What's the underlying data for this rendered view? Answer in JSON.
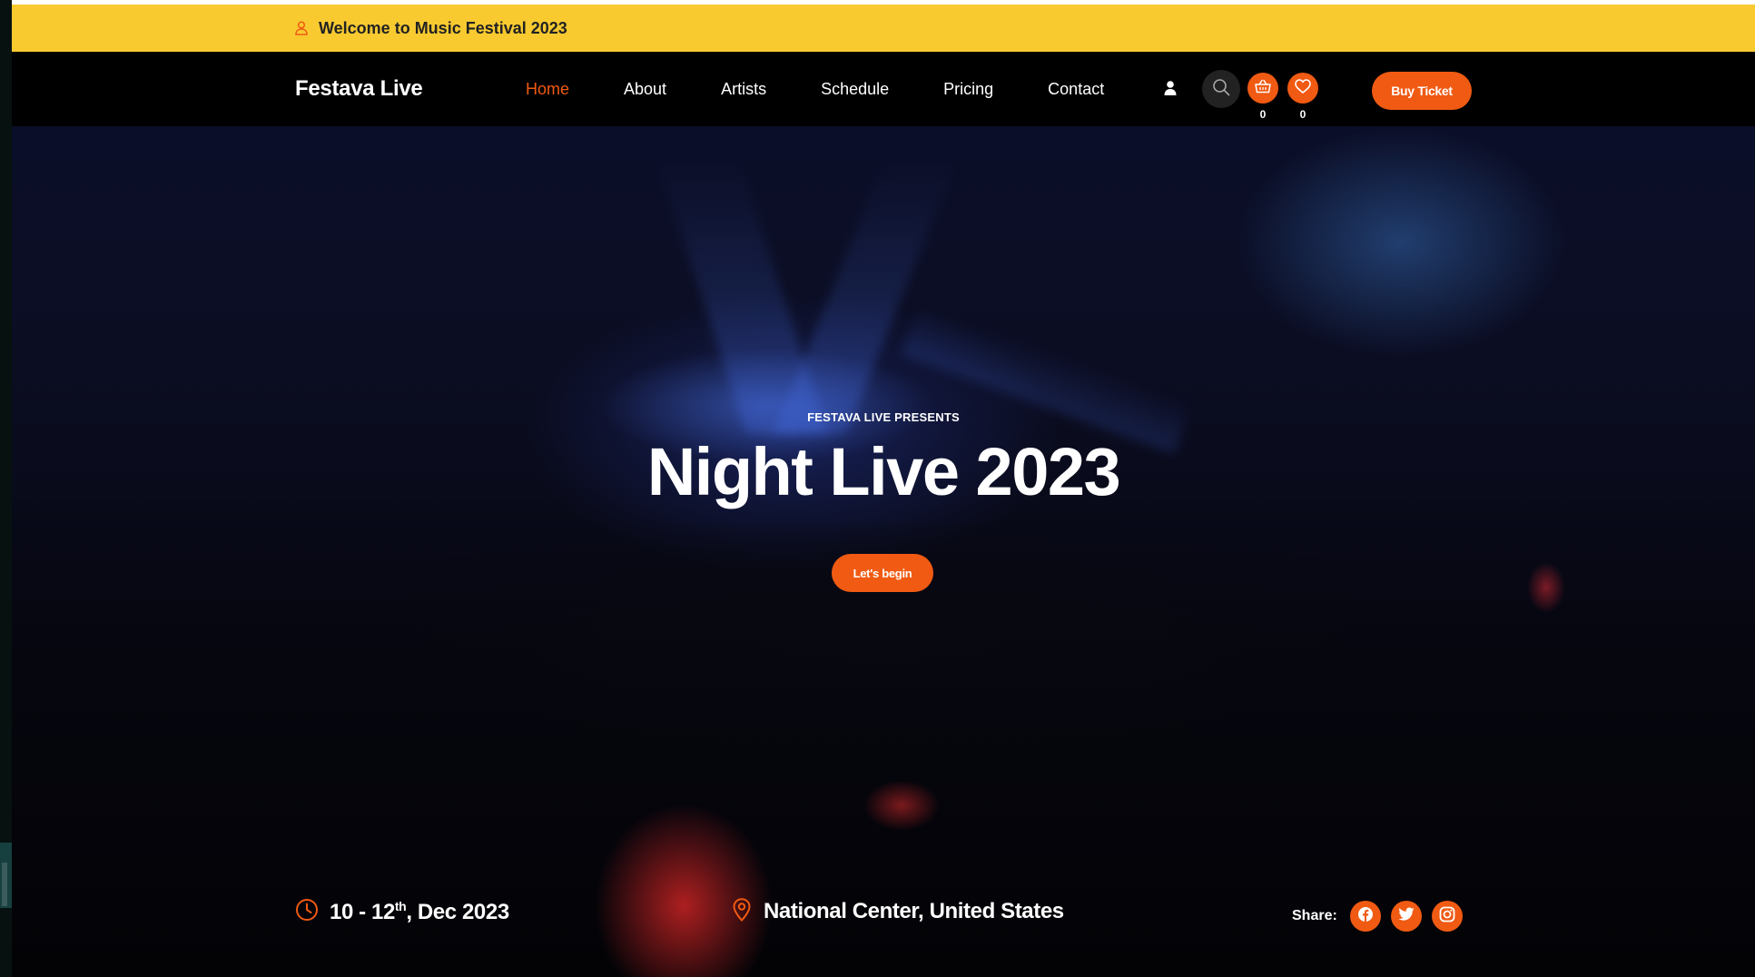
{
  "colors": {
    "accent": "#f05a12",
    "announcement_bg": "#f8ca30",
    "nav_bg": "#000000"
  },
  "announcement": {
    "icon": "user-outline-icon",
    "text": "Welcome to Music Festival 2023"
  },
  "header": {
    "logo": "Festava Live",
    "nav": [
      {
        "label": "Home",
        "active": true
      },
      {
        "label": "About",
        "active": false
      },
      {
        "label": "Artists",
        "active": false
      },
      {
        "label": "Schedule",
        "active": false
      },
      {
        "label": "Pricing",
        "active": false
      },
      {
        "label": "Contact",
        "active": false
      }
    ],
    "icons": [
      "user-icon",
      "search-icon",
      "cart-icon",
      "heart-icon"
    ],
    "cart_count": "0",
    "wishlist_count": "0",
    "buy_ticket_label": "Buy Ticket"
  },
  "hero": {
    "kicker": "FESTAVA LIVE PRESENTS",
    "title": "Night Live 2023",
    "cta_label": "Let's begin"
  },
  "event_info": {
    "date_main": "10 - 12",
    "date_sup": "th",
    "date_rest": ", Dec 2023",
    "date_icon": "clock-icon",
    "location": "National Center, United States",
    "location_icon": "map-pin-icon"
  },
  "share": {
    "label": "Share:",
    "networks": [
      "facebook-icon",
      "twitter-icon",
      "instagram-icon"
    ]
  }
}
